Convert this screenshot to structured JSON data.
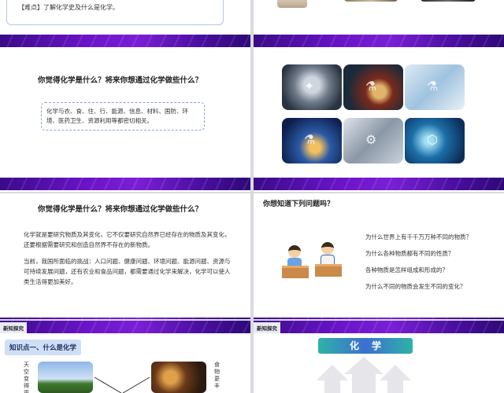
{
  "slide1": {
    "difficulty_note": "【难点】了解化学史及什么是化学。"
  },
  "slide3": {
    "question": "你觉得化学是什么？将来你想通过化学做些什么？",
    "answer": "化学与衣、食、住、行、能源、信息、材料、国防、环境、医药卫生、资源利用等都密切相关。"
  },
  "slide5": {
    "question": "你觉得化学是什么？将来你想通过化学做些什么？",
    "paragraph1": "化学就是要研究物质及其变化，它不仅要研究自然界已经存在的物质及其变化，还要根据需要研究和创造自然界不存在的新物质。",
    "paragraph2": "当前，我国所面临的挑战：人口问题、健康问题、环境问题、能源问题、资源与可持续发展问题，还有农业和食品问题，都需要通过化学来解决，化学可以使人类生活得更加美好。"
  },
  "slide6": {
    "title": "你想知道下列问题吗？",
    "questions": [
      "为什么世界上有千千万万种不同的物质？",
      "为什么各种物质都有不同的性质？",
      "各种物质是怎样组成和形成的？",
      "为什么不同的物质会发生不同的变化？"
    ]
  },
  "slide7": {
    "tag": "新知探究",
    "knowledge_point": "知识点一、什么是化学",
    "left_vertical": "天空变得更",
    "right_vertical": "食物更丰"
  },
  "slide8": {
    "tag": "新知探究",
    "heading": "化学"
  },
  "colors": {
    "banner": "#6a14c8",
    "accent": "#3c6fd0"
  }
}
